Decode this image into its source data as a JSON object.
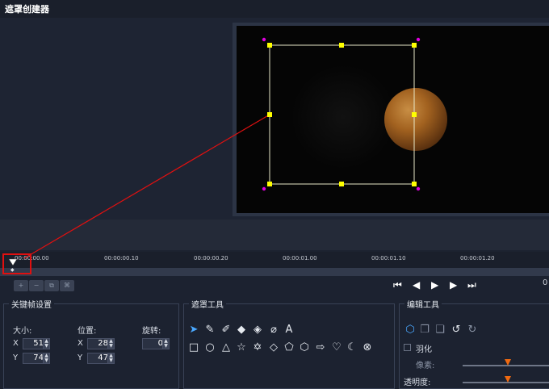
{
  "window": {
    "title": "遮罩创建器"
  },
  "timeline": {
    "ticks": [
      "00:00:00.00",
      "00:00:00.10",
      "00:00:00.20",
      "00:00:01.00",
      "00:00:01.10",
      "00:00:01.20"
    ],
    "keyframe_marker": "◆",
    "end_value": "0"
  },
  "keyframe_tools": [
    {
      "name": "add-keyframe-icon",
      "glyph": "+"
    },
    {
      "name": "remove-keyframe-icon",
      "glyph": "−"
    },
    {
      "name": "copy-keyframe-icon",
      "glyph": "⧉"
    },
    {
      "name": "paste-keyframe-icon",
      "glyph": "⌘"
    }
  ],
  "playback": [
    {
      "name": "go-to-start-icon",
      "glyph": "⏮"
    },
    {
      "name": "previous-frame-icon",
      "glyph": "◀"
    },
    {
      "name": "play-icon",
      "glyph": "▶"
    },
    {
      "name": "next-frame-icon",
      "glyph": "▶"
    },
    {
      "name": "go-to-end-icon",
      "glyph": "⏭"
    }
  ],
  "keyframe_settings": {
    "title": "关键帧设置",
    "size_label": "大小:",
    "position_label": "位置:",
    "rotation_label": "旋转:",
    "x_label": "X",
    "y_label": "Y",
    "size_x": "51",
    "size_y": "74",
    "pos_x": "28",
    "pos_y": "47",
    "rotation": "0"
  },
  "mask_tools": {
    "title": "遮罩工具",
    "row1": [
      {
        "name": "select-arrow-icon",
        "glyph": "➤"
      },
      {
        "name": "brush-icon",
        "glyph": "✎"
      },
      {
        "name": "smart-brush-icon",
        "glyph": "✐"
      },
      {
        "name": "eraser-icon",
        "glyph": "◆"
      },
      {
        "name": "smart-eraser-icon",
        "glyph": "◈"
      },
      {
        "name": "lasso-icon",
        "glyph": "⌀"
      },
      {
        "name": "text-icon",
        "glyph": "A"
      }
    ],
    "row2": [
      {
        "name": "rectangle-icon",
        "glyph": "□"
      },
      {
        "name": "ellipse-icon",
        "glyph": "○"
      },
      {
        "name": "triangle-icon",
        "glyph": "△"
      },
      {
        "name": "star-icon",
        "glyph": "☆"
      },
      {
        "name": "six-point-star-icon",
        "glyph": "✡"
      },
      {
        "name": "diamond-icon",
        "glyph": "◇"
      },
      {
        "name": "pentagon-icon",
        "glyph": "⬠"
      },
      {
        "name": "hexagon-icon",
        "glyph": "⬡"
      },
      {
        "name": "arrow-shape-icon",
        "glyph": "⇨"
      },
      {
        "name": "heart-icon",
        "glyph": "♡"
      },
      {
        "name": "crescent-icon",
        "glyph": "☾"
      },
      {
        "name": "clear-icon",
        "glyph": "⊗"
      }
    ]
  },
  "edit_tools": {
    "title": "编辑工具",
    "icons": [
      {
        "name": "edit-points-icon",
        "glyph": "⬡"
      },
      {
        "name": "duplicate-icon",
        "glyph": "❐"
      },
      {
        "name": "merge-icon",
        "glyph": "❏"
      },
      {
        "name": "undo-icon",
        "glyph": "↺"
      },
      {
        "name": "redo-icon",
        "glyph": "↻"
      }
    ],
    "feather_label": "羽化",
    "pixel_label": "像素:",
    "opacity_label": "透明度:",
    "feather_value": 0.52,
    "opacity_value": 0.52
  },
  "colors": {
    "accent_orange": "#f06a10",
    "handle_yellow": "#ffff00",
    "handle_magenta": "#e000e0",
    "callout_red": "#e01010"
  }
}
